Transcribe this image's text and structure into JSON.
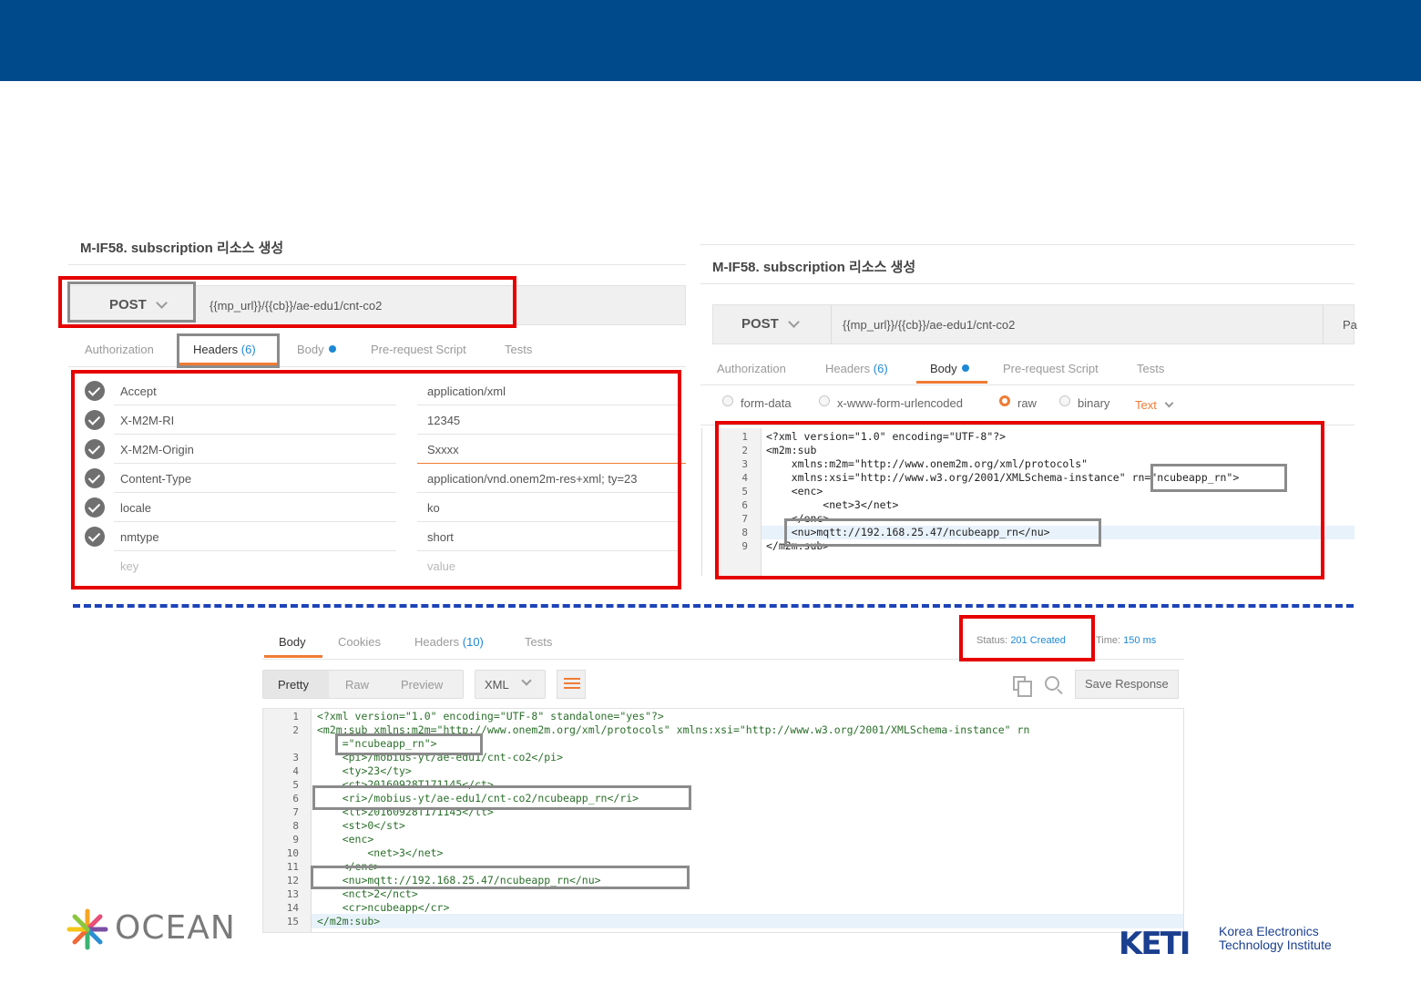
{
  "left_panel": {
    "title": "M-IF58. subscription 리소스 생성",
    "method": "POST",
    "url": "{{mp_url}}/{{cb}}/ae-edu1/cnt-co2",
    "tabs": {
      "authorization": "Authorization",
      "headers": "Headers",
      "headers_count": "(6)",
      "body": "Body",
      "prerequest": "Pre-request Script",
      "tests": "Tests"
    },
    "headers": [
      {
        "key": "Accept",
        "value": "application/xml"
      },
      {
        "key": "X-M2M-RI",
        "value": "12345"
      },
      {
        "key": "X-M2M-Origin",
        "value": "Sxxxx"
      },
      {
        "key": "Content-Type",
        "value": "application/vnd.onem2m-res+xml; ty=23"
      },
      {
        "key": "locale",
        "value": "ko"
      },
      {
        "key": "nmtype",
        "value": "short"
      }
    ],
    "key_placeholder": "key",
    "value_placeholder": "value"
  },
  "right_panel": {
    "title": "M-IF58. subscription 리소스 생성",
    "method": "POST",
    "url": "{{mp_url}}/{{cb}}/ae-edu1/cnt-co2",
    "params_cut": "Pa",
    "tabs": {
      "authorization": "Authorization",
      "headers": "Headers",
      "headers_count": "(6)",
      "body": "Body",
      "prerequest": "Pre-request Script",
      "tests": "Tests"
    },
    "body_modes": [
      "form-data",
      "x-www-form-urlencoded",
      "raw",
      "binary"
    ],
    "content_type": "Text",
    "code_lines": [
      "<?xml version=\"1.0\" encoding=\"UTF-8\"?>",
      "<m2m:sub",
      "    xmlns:m2m=\"http://www.onem2m.org/xml/protocols\"",
      "    xmlns:xsi=\"http://www.w3.org/2001/XMLSchema-instance\" rn=\"ncubeapp_rn\">",
      "    <enc>",
      "         <net>3</net>",
      "    </enc>",
      "    <nu>mqtt://192.168.25.47/ncubeapp_rn</nu>",
      "</m2m:sub>"
    ]
  },
  "response": {
    "tabs": {
      "body": "Body",
      "cookies": "Cookies",
      "headers": "Headers",
      "headers_count": "(10)",
      "tests": "Tests"
    },
    "status_label": "Status:",
    "status_value": "201 Created",
    "time_label": "Time:",
    "time_value": "150 ms",
    "view_modes": [
      "Pretty",
      "Raw",
      "Preview"
    ],
    "format": "XML",
    "save_label": "Save Response",
    "code_lines": [
      {
        "n": "1",
        "text": "<?xml version=\"1.0\" encoding=\"UTF-8\" standalone=\"yes\"?>"
      },
      {
        "n": "2",
        "text": "<m2m:sub xmlns:m2m=\"http://www.onem2m.org/xml/protocols\" xmlns:xsi=\"http://www.w3.org/2001/XMLSchema-instance\" rn"
      },
      {
        "n": "",
        "text": "    =\"ncubeapp_rn\">"
      },
      {
        "n": "3",
        "text": "    <pi>/mobius-yt/ae-edu1/cnt-co2</pi>"
      },
      {
        "n": "4",
        "text": "    <ty>23</ty>"
      },
      {
        "n": "5",
        "text": "    <ct>20160928T171145</ct>"
      },
      {
        "n": "6",
        "text": "    <ri>/mobius-yt/ae-edu1/cnt-co2/ncubeapp_rn</ri>"
      },
      {
        "n": "7",
        "text": "    <lt>20160928T171145</lt>"
      },
      {
        "n": "8",
        "text": "    <st>0</st>"
      },
      {
        "n": "9",
        "text": "    <enc>"
      },
      {
        "n": "10",
        "text": "        <net>3</net>"
      },
      {
        "n": "11",
        "text": "    </enc>"
      },
      {
        "n": "12",
        "text": "    <nu>mqtt://192.168.25.47/ncubeapp_rn</nu>"
      },
      {
        "n": "13",
        "text": "    <nct>2</nct>"
      },
      {
        "n": "14",
        "text": "    <cr>ncubeapp</cr>"
      },
      {
        "n": "15",
        "text": "</m2m:sub>"
      }
    ]
  },
  "logos": {
    "ocean": "OCEAN",
    "keti_mark": "KETI",
    "keti_line1": "Korea Electronics",
    "keti_line2": "Technology Institute"
  },
  "colors": {
    "header_bar": "#004a8b",
    "highlight_red": "#e60000",
    "accent_orange": "#f07b34",
    "link_blue": "#1e88d6"
  }
}
